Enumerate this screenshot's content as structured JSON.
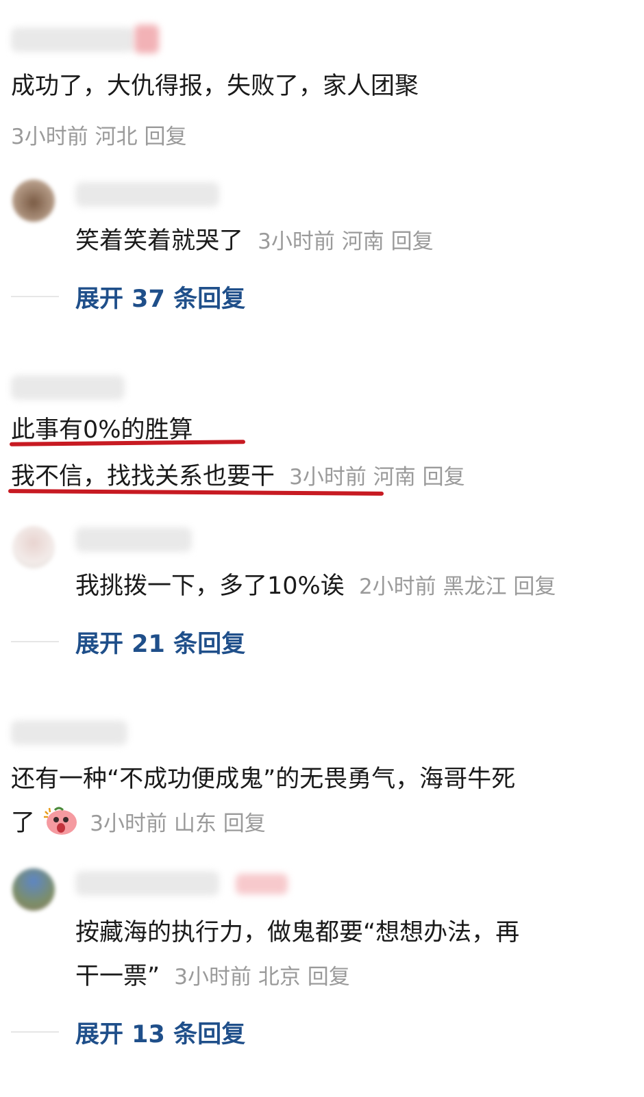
{
  "comments": [
    {
      "text": "成功了，大仇得报，失败了，家人团聚",
      "time": "3小时前",
      "location": "河北",
      "reply": "回复"
    },
    {
      "text": "笑着笑着就哭了",
      "time": "3小时前",
      "location": "河南",
      "reply": "回复",
      "expand": "展开 37 条回复"
    },
    {
      "line1": "此事有0%的胜算",
      "line2": "我不信，找找关系也要干",
      "time": "3小时前",
      "location": "河南",
      "reply": "回复"
    },
    {
      "text": "我挑拨一下，多了10%诶",
      "time": "2小时前",
      "location": "黑龙江",
      "reply": "回复",
      "expand": "展开 21 条回复"
    },
    {
      "line1": "还有一种“不成功便成鬼”的无畏勇气，海哥牛死",
      "line2": "了",
      "time": "3小时前",
      "location": "山东",
      "reply": "回复"
    },
    {
      "line1": "按藏海的执行力，做鬼都要“想想办法，再",
      "line2": "干一票”",
      "time": "3小时前",
      "location": "北京",
      "reply": "回复",
      "expand": "展开 13 条回复"
    }
  ],
  "colors": {
    "underline": "#c71a22",
    "expand_link": "#1f4f8a",
    "meta_text": "#9a9a9a"
  }
}
